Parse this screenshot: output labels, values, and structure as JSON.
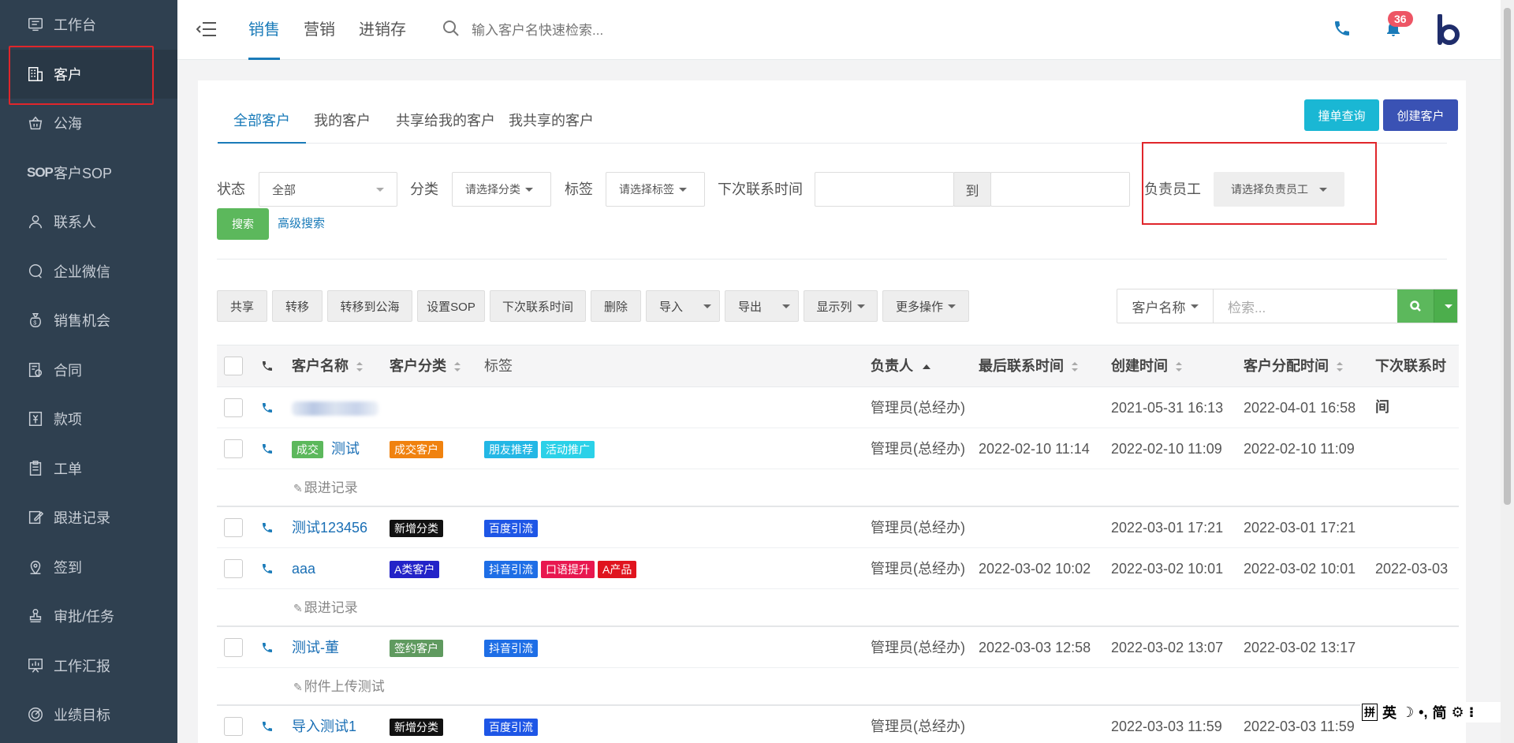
{
  "sidebar": {
    "items": [
      {
        "label": "工作台",
        "icon": "monitor-icon"
      },
      {
        "label": "客户",
        "icon": "building-icon"
      },
      {
        "label": "公海",
        "icon": "basket-icon"
      },
      {
        "label": "客户SOP",
        "icon": "sop-text-icon",
        "icon_text": "SOP"
      },
      {
        "label": "联系人",
        "icon": "person-icon"
      },
      {
        "label": "企业微信",
        "icon": "chat-icon"
      },
      {
        "label": "销售机会",
        "icon": "money-bag-icon"
      },
      {
        "label": "合同",
        "icon": "contract-icon"
      },
      {
        "label": "款项",
        "icon": "yen-icon"
      },
      {
        "label": "工单",
        "icon": "clipboard-icon"
      },
      {
        "label": "跟进记录",
        "icon": "edit-icon"
      },
      {
        "label": "签到",
        "icon": "location-pin-icon"
      },
      {
        "label": "审批/任务",
        "icon": "stamp-icon"
      },
      {
        "label": "工作汇报",
        "icon": "report-icon"
      },
      {
        "label": "业绩目标",
        "icon": "target-icon"
      }
    ],
    "active_index": 1
  },
  "topbar": {
    "tabs": [
      "销售",
      "营销",
      "进销存"
    ],
    "active_tab": 0,
    "search_placeholder": "输入客户名快速检索...",
    "notification_count": "36"
  },
  "card": {
    "sub_tabs": [
      "全部客户",
      "我的客户",
      "共享给我的客户",
      "我共享的客户"
    ],
    "btn_check": "撞单查询",
    "btn_create": "创建客户"
  },
  "filters": {
    "status_label": "状态",
    "status_value": "全部",
    "category_label": "分类",
    "category_value": "请选择分类",
    "tag_label": "标签",
    "tag_value": "请选择标签",
    "next_contact_label": "下次联系时间",
    "range_sep": "到",
    "owner_label": "负责员工",
    "owner_value": "请选择负责员工",
    "search_btn": "搜索",
    "advanced_link": "高级搜索"
  },
  "toolbar": {
    "buttons": [
      "共享",
      "转移",
      "转移到公海",
      "设置SOP",
      "下次联系时间",
      "删除",
      "导入",
      "导出",
      "显示列",
      "更多操作"
    ],
    "search_field": "客户名称",
    "search_placeholder": "检索..."
  },
  "table": {
    "headers": [
      "客户名称",
      "客户分类",
      "标签",
      "负责人",
      "最后联系时间",
      "创建时间",
      "客户分配时间",
      "下次联系时间"
    ],
    "rows": [
      {
        "status_tag": "",
        "name": "",
        "category": "",
        "tags": [],
        "owner": "管理员(总经办)",
        "last_contact": "",
        "created": "2021-05-31 16:13",
        "assigned": "2022-04-01 16:58",
        "next_contact": "",
        "sub": ""
      },
      {
        "status_tag": "成交",
        "name": "测试",
        "category": "成交客户",
        "tags": [
          "朋友推荐",
          "活动推广"
        ],
        "owner": "管理员(总经办)",
        "last_contact": "2022-02-10 11:14",
        "created": "2022-02-10 11:09",
        "assigned": "2022-02-10 11:09",
        "next_contact": "",
        "sub": "跟进记录"
      },
      {
        "status_tag": "",
        "name": "测试123456",
        "category": "新增分类",
        "tags": [
          "百度引流"
        ],
        "owner": "管理员(总经办)",
        "last_contact": "",
        "created": "2022-03-01 17:21",
        "assigned": "2022-03-01 17:21",
        "next_contact": "",
        "sub": ""
      },
      {
        "status_tag": "",
        "name": "aaa",
        "category": "A类客户",
        "tags": [
          "抖音引流",
          "口语提升",
          "A产品"
        ],
        "owner": "管理员(总经办)",
        "last_contact": "2022-03-02 10:02",
        "created": "2022-03-02 10:01",
        "assigned": "2022-03-02 10:01",
        "next_contact": "2022-03-03",
        "sub": "跟进记录"
      },
      {
        "status_tag": "",
        "name": "测试-董",
        "category": "签约客户",
        "tags": [
          "抖音引流"
        ],
        "owner": "管理员(总经办)",
        "last_contact": "2022-03-03 12:58",
        "created": "2022-03-02 13:07",
        "assigned": "2022-03-02 13:17",
        "next_contact": "",
        "sub": "附件上传测试"
      },
      {
        "status_tag": "",
        "name": "导入测试1",
        "category": "新增分类",
        "tags": [
          "百度引流"
        ],
        "owner": "管理员(总经办)",
        "last_contact": "",
        "created": "2022-03-03 11:59",
        "assigned": "2022-03-03 11:59",
        "next_contact": "",
        "sub": ""
      }
    ]
  },
  "colors": {
    "成交": "#5cb85c",
    "成交客户": "#f0820f",
    "新增分类": "#111111",
    "A类客户": "#2323c8",
    "签约客户": "#5f9a5f",
    "朋友推荐": "#23b7e5",
    "活动推广": "#2bd1e8",
    "百度引流": "#1e56e6",
    "抖音引流": "#1e6ee6",
    "口语提升": "#e8174f",
    "A产品": "#e0141e"
  },
  "ime": {
    "items": [
      "拼",
      "英",
      "简"
    ]
  }
}
